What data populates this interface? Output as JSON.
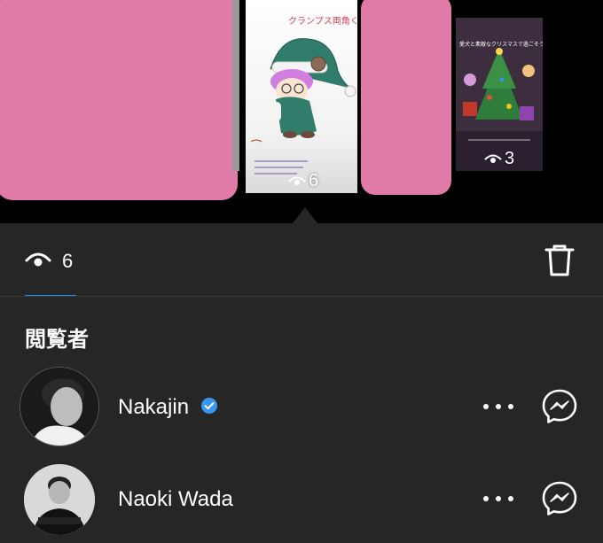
{
  "stories": {
    "center": {
      "title_text": "クランプス両角くん",
      "views": "6"
    },
    "right": {
      "title_text": "愛犬と素敵なクリスマスで過ごそう♪",
      "views": "3"
    }
  },
  "views_summary": {
    "icon": "eye-icon",
    "count": "6"
  },
  "actions": {
    "delete_icon": "trash-icon"
  },
  "viewers_section": {
    "title": "閲覧者",
    "viewers": [
      {
        "name": "Nakajin",
        "verified": true
      },
      {
        "name": "Naoki Wada",
        "verified": false
      }
    ]
  },
  "colors": {
    "background": "#262626",
    "top_strip": "#000000",
    "accent_underline": "#1f8fff",
    "verified_badge": "#3797f0",
    "redaction_pink": "#e07aa6"
  }
}
